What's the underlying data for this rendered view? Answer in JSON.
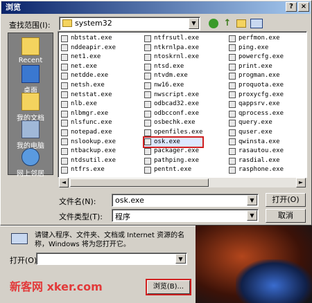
{
  "dialog": {
    "title": "浏览",
    "look_in_label": "查找范围(I):",
    "look_in_value": "system32",
    "file_name_label": "文件名(N):",
    "file_name_value": "osk.exe",
    "file_type_label": "文件类型(T):",
    "file_type_value": "程序",
    "open_button": "打开(O)",
    "cancel_button": "取消",
    "help_glyph": "?",
    "close_glyph": "×"
  },
  "places": [
    {
      "label": "Recent",
      "icon": "recent-folder-icon"
    },
    {
      "label": "桌面",
      "icon": "desktop-icon"
    },
    {
      "label": "我的文档",
      "icon": "my-documents-icon"
    },
    {
      "label": "我的电脑",
      "icon": "my-computer-icon"
    },
    {
      "label": "网上邻居",
      "icon": "network-places-icon"
    }
  ],
  "files": {
    "col1": [
      "nbtstat.exe",
      "nddeapir.exe",
      "net1.exe",
      "net.exe",
      "netdde.exe",
      "netsh.exe",
      "netstat.exe",
      "nlb.exe",
      "nlbmgr.exe",
      "nlsfunc.exe",
      "notepad.exe",
      "nslookup.exe",
      "ntbackup.exe",
      "ntdsutil.exe",
      "ntfrs.exe"
    ],
    "col2": [
      "ntfrsutl.exe",
      "ntkrnlpa.exe",
      "ntoskrnl.exe",
      "ntsd.exe",
      "ntvdm.exe",
      "nw16.exe",
      "nwscript.exe",
      "odbcad32.exe",
      "odbcconf.exe",
      "osbechk.exe",
      "openfiles.exe",
      "osk.exe",
      "packager.exe",
      "pathping.exe",
      "pentnt.exe"
    ],
    "col3": [
      "perfmon.exe",
      "ping.exe",
      "powercfg.exe",
      "print.exe",
      "progman.exe",
      "proquota.exe",
      "proxycfg.exe",
      "qappsrv.exe",
      "qprocess.exe",
      "query.exe",
      "quser.exe",
      "qwinsta.exe",
      "rasautou.exe",
      "rasdial.exe",
      "rasphone.exe"
    ],
    "selected": "osk.exe"
  },
  "run_dialog": {
    "description_line1": "请键入程序、文件夹、文档或 Internet 资源的名",
    "description_line2": "称，Windows 将为您打开它。",
    "open_label": "打开(O)",
    "browse_button": "浏览(B)...",
    "watermark": "新客网 xker.com"
  },
  "colors": {
    "title_start": "#0a246a",
    "title_end": "#a6caf0",
    "selection_outline": "#d02020"
  }
}
